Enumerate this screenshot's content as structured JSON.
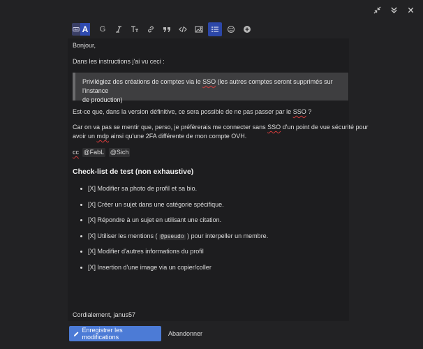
{
  "window": {
    "minimize_icon": "collapse-icon",
    "chevron_icon": "double-chevron-down-icon",
    "close_icon": "close-icon"
  },
  "toolbar": {
    "toggle_letter": "A",
    "heading_letter": "G",
    "items": [
      "rich-text-toggle",
      "bold",
      "italic",
      "text-size",
      "link",
      "quote",
      "code",
      "image",
      "bullet-list",
      "emoji",
      "more"
    ]
  },
  "editor": {
    "greeting": "Bonjour,",
    "intro": "Dans les instructions j'ai vu ceci :",
    "quote_part1": "Privilégiez des créations de comptes via le ",
    "quote_sso": "SSO",
    "quote_part2": " (les autres comptes seront supprimés sur l'instance",
    "quote_line2": "de production)",
    "question_part1": "Est-ce que, dans la version définitive, ce sera possible de ne pas passer par le ",
    "question_sso": "SSO",
    "question_part2": " ?",
    "para_line1_a": "Car on va pas se mentir que, perso, je préfèrerais me connecter sans ",
    "para_line1_sso": "SSO",
    "para_line1_b": " d'un point de vue sécurité pour",
    "para_line2_a": "avoir un ",
    "para_line2_mdp": "mdp",
    "para_line2_b": " ainsi qu'une 2FA différente de mon compte OVH.",
    "cc_label": "cc",
    "mention1": "@FabL",
    "mention2": "@Sich",
    "heading": "Check-list de test (non exhaustive)",
    "checklist": [
      "[X] Modifier sa photo de profil et sa bio.",
      "[X] Créer un sujet dans une catégorie spécifique.",
      "[X] Répondre à un sujet en utilisant une citation.",
      "[X] Modifier d'autres informations du profil",
      "[X] Insertion d'une image via un copier/coller"
    ],
    "mentions_item_before": "[X] Utiliser les mentions ( ",
    "mentions_item_code": "@pseudo",
    "mentions_item_after": " ) pour interpeller un membre.",
    "signature": "Cordialement, janus57"
  },
  "footer": {
    "save_label": "Enregistrer les modifications",
    "cancel_label": "Abandonner"
  },
  "colors": {
    "accent": "#4c7bd6",
    "toolbar_active": "#2c47a8",
    "background": "#222224",
    "editor_bg": "#1d1d1f"
  }
}
